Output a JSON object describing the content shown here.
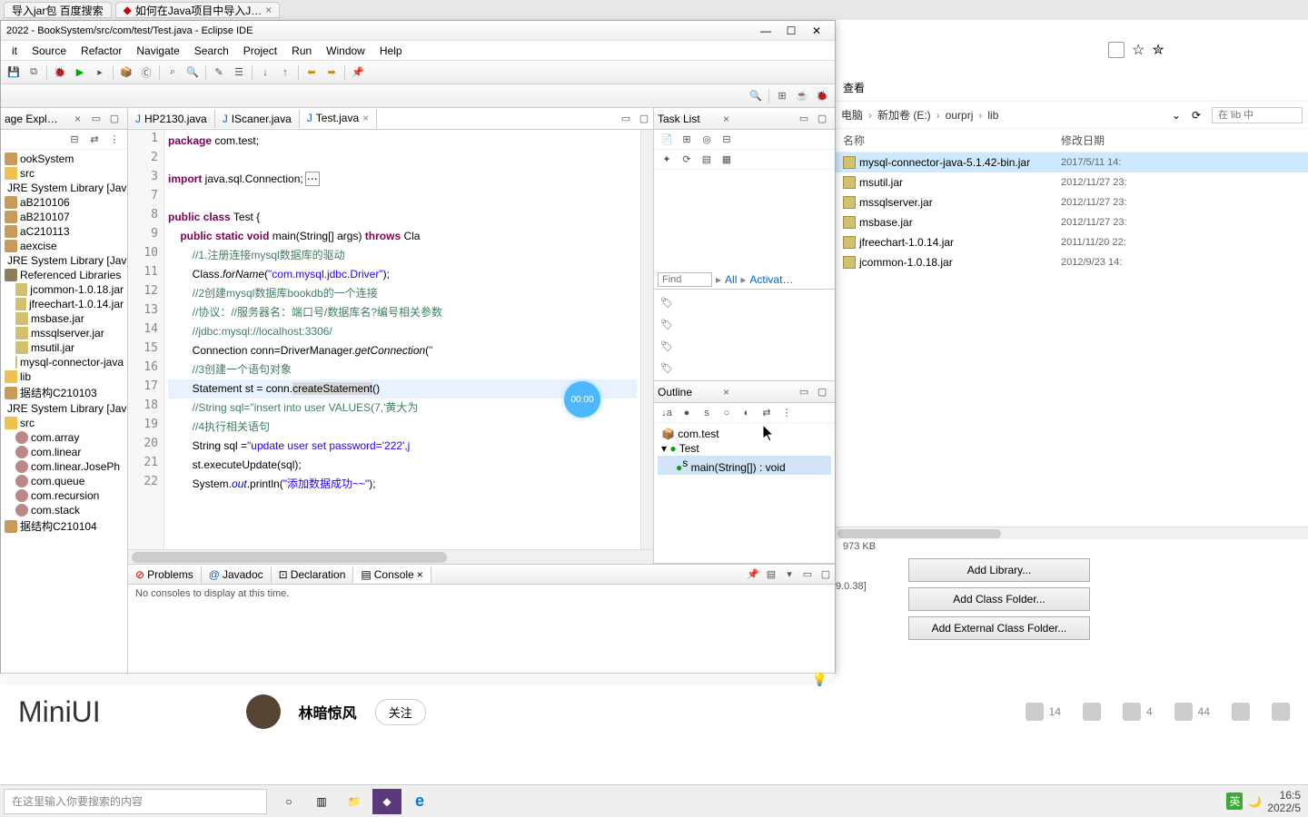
{
  "browser": {
    "tab1": "导入jar包 百度搜索",
    "tab2": "如何在Java项目中导入J…",
    "toolbar_view": "查看"
  },
  "eclipse": {
    "title": "2022 - BookSystem/src/com/test/Test.java - Eclipse IDE",
    "menu": [
      "it",
      "Source",
      "Refactor",
      "Navigate",
      "Search",
      "Project",
      "Run",
      "Window",
      "Help"
    ],
    "package_explorer_tab": "age Expl…",
    "tree": {
      "i0": "ookSystem",
      "i1": "src",
      "i2": "JRE System Library [Java",
      "i3": "aB210106",
      "i4": "aB210107",
      "i5": "aC210113",
      "i6": "aexcise",
      "i7": "JRE System Library [Java",
      "i8": "Referenced Libraries",
      "i9": "jcommon-1.0.18.jar",
      "i10": "jfreechart-1.0.14.jar",
      "i11": "msbase.jar",
      "i12": "mssqlserver.jar",
      "i13": "msutil.jar",
      "i14": "mysql-connector-java",
      "i15": "lib",
      "i16": "据结构C210103",
      "i17": "JRE System Library [Java",
      "i18": "src",
      "i19": "com.array",
      "i20": "com.linear",
      "i21": "com.linear.JosePh",
      "i22": "com.queue",
      "i23": "com.recursion",
      "i24": "com.stack",
      "i25": "据结构C210104"
    },
    "editor_tabs": {
      "t1": "HP2130.java",
      "t2": "IScaner.java",
      "t3": "Test.java"
    },
    "line_numbers": [
      "1",
      "2",
      "3",
      "7",
      "8",
      "9",
      "10",
      "11",
      "12",
      "13",
      "14",
      "15",
      "16",
      "17",
      "18",
      "19",
      "20",
      "21",
      "22"
    ],
    "code": {
      "l1_kw1": "package",
      "l1_rest": " com.test;",
      "l3_kw1": "import",
      "l3_rest": " java.sql.Connection;",
      "l8_kw1": "public",
      "l8_kw2": "class",
      "l8_rest": " Test {",
      "l9_kw1": "public",
      "l9_kw2": "static",
      "l9_kw3": "void",
      "l9_m": " main(String[] args) ",
      "l9_kw4": "throws",
      "l9_rest": " Cla",
      "l10": "//1.注册连接mysql数据库的驱动",
      "l11_a": "Class.",
      "l11_b": "forName",
      "l11_c": "(",
      "l11_str": "\"com.mysql.jdbc.Driver\"",
      "l11_d": ");",
      "l12": "//2创建mysql数据库bookdb的一个连接",
      "l13": "//协议：//服务器名：端口号/数据库名?编号相关参数",
      "l14": "//jdbc:mysql://localhost:3306/",
      "l15_a": "Connection conn=DriverManager.",
      "l15_b": "getConnection",
      "l15_c": "(",
      "l16": "//3创建一个语句对象",
      "l17_a": "Statement st = conn.",
      "l17_b": "createStatement",
      "l17_c": "()",
      "l18_a": "//String sql=\"insert into user VALUES(7,'黄大为",
      "l19": "//4执行相关语句",
      "l20_a": "String sql =",
      "l20_str": "\"update user set password='222',j",
      "l21": "st.executeUpdate(sql);",
      "l22_a": "System.",
      "l22_b": "out",
      "l22_c": ".println(",
      "l22_str": "\"添加数据成功~~\"",
      "l22_d": ");"
    },
    "timer": "00:00",
    "tasklist": {
      "title": "Task List",
      "find": "Find",
      "all": "All",
      "activate": "Activat…"
    },
    "outline": {
      "title": "Outline",
      "pkg": "com.test",
      "cls": "Test",
      "method": "main(String[]) : void"
    },
    "console_tabs": {
      "problems": "Problems",
      "javadoc": "Javadoc",
      "declaration": "Declaration",
      "console": "Console"
    },
    "console_msg": "No consoles to display at this time.",
    "fragment1": "973 KB",
    "fragment2": "9.0.38]"
  },
  "file_explorer": {
    "breadcrumb": {
      "c1": "电脑",
      "c2": "新加卷 (E:)",
      "c3": "ourprj",
      "c4": "lib"
    },
    "search_placeholder": "在 lib 中",
    "col_name": "名称",
    "col_date": "修改日期",
    "rows": {
      "r0n": "mysql-connector-java-5.1.42-bin.jar",
      "r0d": "2017/5/11 14:",
      "r1n": "msutil.jar",
      "r1d": "2012/11/27 23:",
      "r2n": "mssqlserver.jar",
      "r2d": "2012/11/27 23:",
      "r3n": "msbase.jar",
      "r3d": "2012/11/27 23:",
      "r4n": "jfreechart-1.0.14.jar",
      "r4d": "2011/11/20 22:",
      "r5n": "jcommon-1.0.18.jar",
      "r5d": "2012/9/23 14:"
    }
  },
  "dialog": {
    "b1": "Add Library...",
    "b2": "Add Class Folder...",
    "b3": "Add External Class Folder..."
  },
  "video": {
    "big": "MiniUI",
    "author": "林暗惊风",
    "follow": "关注",
    "like": "14",
    "dislike": "",
    "comment": "4",
    "fav": "44"
  },
  "taskbar": {
    "search_placeholder": "在这里输入你要搜索的内容",
    "ime": "英",
    "time": "16:5",
    "date": "2022/5"
  }
}
